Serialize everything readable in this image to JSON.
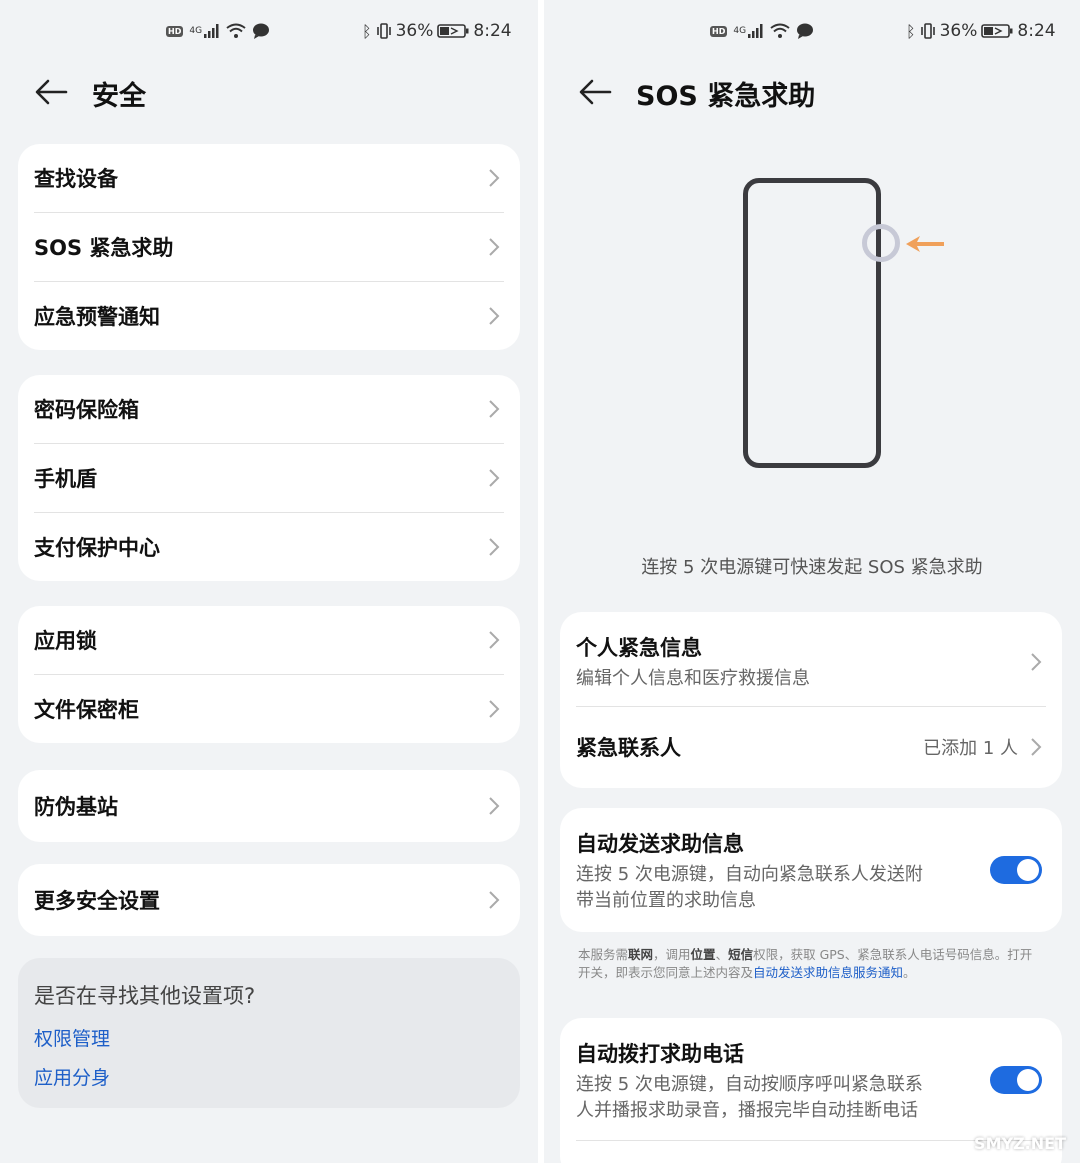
{
  "status": {
    "network": "4G",
    "battery": "36%",
    "time": "8:24",
    "hd": "HD"
  },
  "left": {
    "title": "安全",
    "groups": [
      [
        "查找设备",
        "SOS 紧急求助",
        "应急预警通知"
      ],
      [
        "密码保险箱",
        "手机盾",
        "支付保护中心"
      ],
      [
        "应用锁",
        "文件保密柜"
      ],
      [
        "防伪基站"
      ],
      [
        "更多安全设置"
      ]
    ],
    "hint": {
      "question": "是否在寻找其他设置项?",
      "links": [
        "权限管理",
        "应用分身"
      ]
    }
  },
  "right": {
    "title": "SOS 紧急求助",
    "subtitle": "连按 5 次电源键可快速发起 SOS 紧急求助",
    "card1": {
      "personal_title": "个人紧急信息",
      "personal_desc": "编辑个人信息和医疗救援信息",
      "contact_title": "紧急联系人",
      "contact_value": "已添加 1 人"
    },
    "auto_msg": {
      "title": "自动发送求助信息",
      "desc_line1": "连按 5 次电源键，自动向紧急联系人发送附",
      "desc_line2": "带当前位置的求助信息",
      "enabled": true
    },
    "note": {
      "p1": "本服务需",
      "b1": "联网",
      "p2": "，调用",
      "b2": "位置",
      "p3": "、",
      "b3": "短信",
      "p4": "权限，获取 GPS、紧急联系人电话号码信息。打开开关，即表示您同意上述内容及",
      "link": "自动发送求助信息服务通知",
      "p5": "。"
    },
    "auto_call": {
      "title": "自动拨打求助电话",
      "desc_line1": "连按 5 次电源键，自动按顺序呼叫紧急联系",
      "desc_line2": "人并播报求助录音，播报完毕自动挂断电话",
      "enabled": true
    }
  },
  "watermark": "SMYZ.NET",
  "colors": {
    "accent": "#1e6be0",
    "link": "#1e5fc8",
    "arrow": "#f0a05a"
  }
}
